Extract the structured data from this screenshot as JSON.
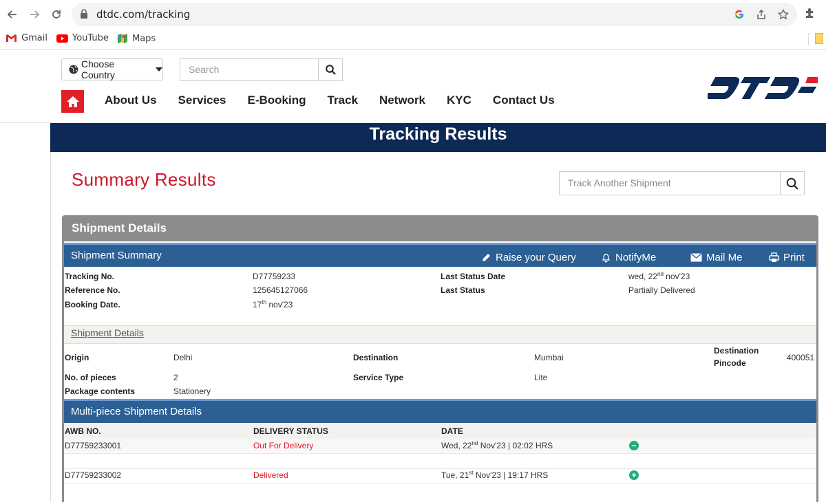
{
  "browser": {
    "url": "dtdc.com/tracking",
    "bookmarks": [
      {
        "label": "Gmail",
        "icon": "gmail-icon"
      },
      {
        "label": "YouTube",
        "icon": "youtube-icon"
      },
      {
        "label": "Maps",
        "icon": "maps-icon"
      }
    ]
  },
  "header": {
    "country_label": "Choose Country",
    "search_placeholder": "Search",
    "menu": [
      "About Us",
      "Services",
      "E-Booking",
      "Track",
      "Network",
      "KYC",
      "Contact Us"
    ],
    "logo_text": "DTDC"
  },
  "banner": {
    "title": "Tracking Results"
  },
  "summary": {
    "title": "Summary Results",
    "track_placeholder": "Track Another Shipment"
  },
  "panel": {
    "title": "Shipment Details",
    "summary_bar": {
      "title": "Shipment Summary",
      "actions": [
        "Raise your Query",
        "NotifyMe",
        "Mail Me",
        "Print"
      ]
    },
    "summary_fields": {
      "tracking_label": "Tracking No.",
      "tracking_value": "D77759233",
      "reference_label": "Reference No.",
      "reference_value": "125645127066",
      "booking_label": "Booking Date.",
      "booking_day": "17",
      "booking_sup": "th",
      "booking_rest": " nov'23",
      "last_status_date_label": "Last Status Date",
      "last_status_date_pre": "wed, 22",
      "last_status_date_sup": "nd",
      "last_status_date_rest": " nov'23",
      "last_status_label": "Last Status",
      "last_status_value": "Partially Delivered"
    },
    "details_sub": "Shipment Details",
    "details": {
      "origin_label": "Origin",
      "origin_value": "Delhi",
      "destination_label": "Destination",
      "destination_value": "Mumbai",
      "dest_pincode_label_1": "Destination",
      "dest_pincode_label_2": "Pincode",
      "dest_pincode_value": "400051",
      "pieces_label": "No. of pieces",
      "pieces_value": "2",
      "service_label": "Service Type",
      "service_value": "Lite",
      "contents_label": "Package contents",
      "contents_value": "Stationery"
    },
    "multipiece_bar": {
      "title": "Multi-piece Shipment Details"
    },
    "table": {
      "headers": [
        "AWB NO.",
        "DELIVERY STATUS",
        "DATE"
      ],
      "rows": [
        {
          "awb": "D77759233001",
          "status": "Out For Delivery",
          "date_pre": "Wed, 22",
          "date_sup": "nd",
          "date_rest": " Nov'23 | 02:02 HRS",
          "icon": "minus-circle-icon",
          "glyph": "−"
        },
        {
          "awb": "D77759233002",
          "status": "Delivered",
          "date_pre": "Tue, 21",
          "date_sup": "st",
          "date_rest": " Nov'23 | 19:17 HRS",
          "icon": "plus-circle-icon",
          "glyph": "+"
        }
      ]
    }
  },
  "colors": {
    "brand_red": "#e21f26",
    "banner_navy": "#0c2a55",
    "bar_blue": "#2c5f93",
    "status_green": "#27ad7a"
  }
}
